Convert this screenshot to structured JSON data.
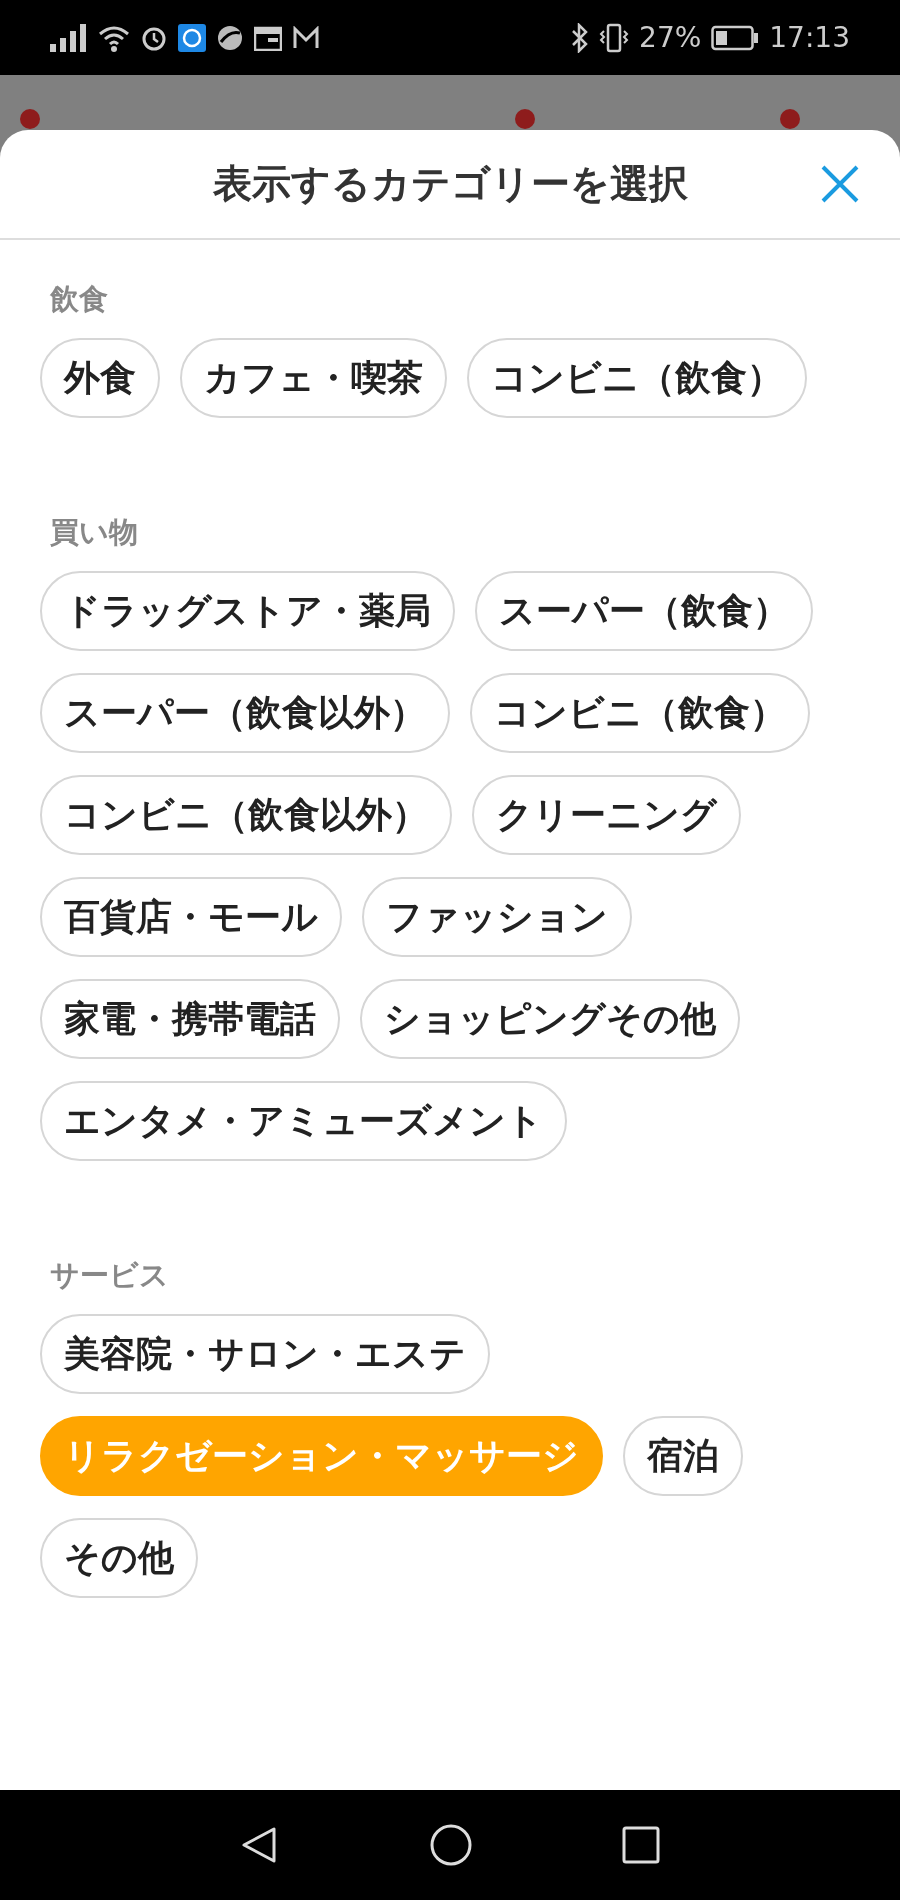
{
  "status_bar": {
    "battery": "27%",
    "time": "17:13"
  },
  "sheet": {
    "title": "表示するカテゴリーを選択",
    "sections": [
      {
        "heading": "飲食",
        "chips": [
          {
            "label": "外食",
            "selected": false
          },
          {
            "label": "カフェ・喫茶",
            "selected": false
          },
          {
            "label": "コンビニ（飲食）",
            "selected": false
          }
        ]
      },
      {
        "heading": "買い物",
        "chips": [
          {
            "label": "ドラッグストア・薬局",
            "selected": false
          },
          {
            "label": "スーパー（飲食）",
            "selected": false
          },
          {
            "label": "スーパー（飲食以外）",
            "selected": false
          },
          {
            "label": "コンビニ（飲食）",
            "selected": false
          },
          {
            "label": "コンビニ（飲食以外）",
            "selected": false
          },
          {
            "label": "クリーニング",
            "selected": false
          },
          {
            "label": "百貨店・モール",
            "selected": false
          },
          {
            "label": "ファッション",
            "selected": false
          },
          {
            "label": "家電・携帯電話",
            "selected": false
          },
          {
            "label": "ショッピングその他",
            "selected": false
          },
          {
            "label": "エンタメ・アミューズメント",
            "selected": false
          }
        ]
      },
      {
        "heading": "サービス",
        "chips": [
          {
            "label": "美容院・サロン・エステ",
            "selected": false
          },
          {
            "label": "リラクゼーション・マッサージ",
            "selected": true
          },
          {
            "label": "宿泊",
            "selected": false
          },
          {
            "label": "その他",
            "selected": false
          }
        ]
      }
    ]
  }
}
